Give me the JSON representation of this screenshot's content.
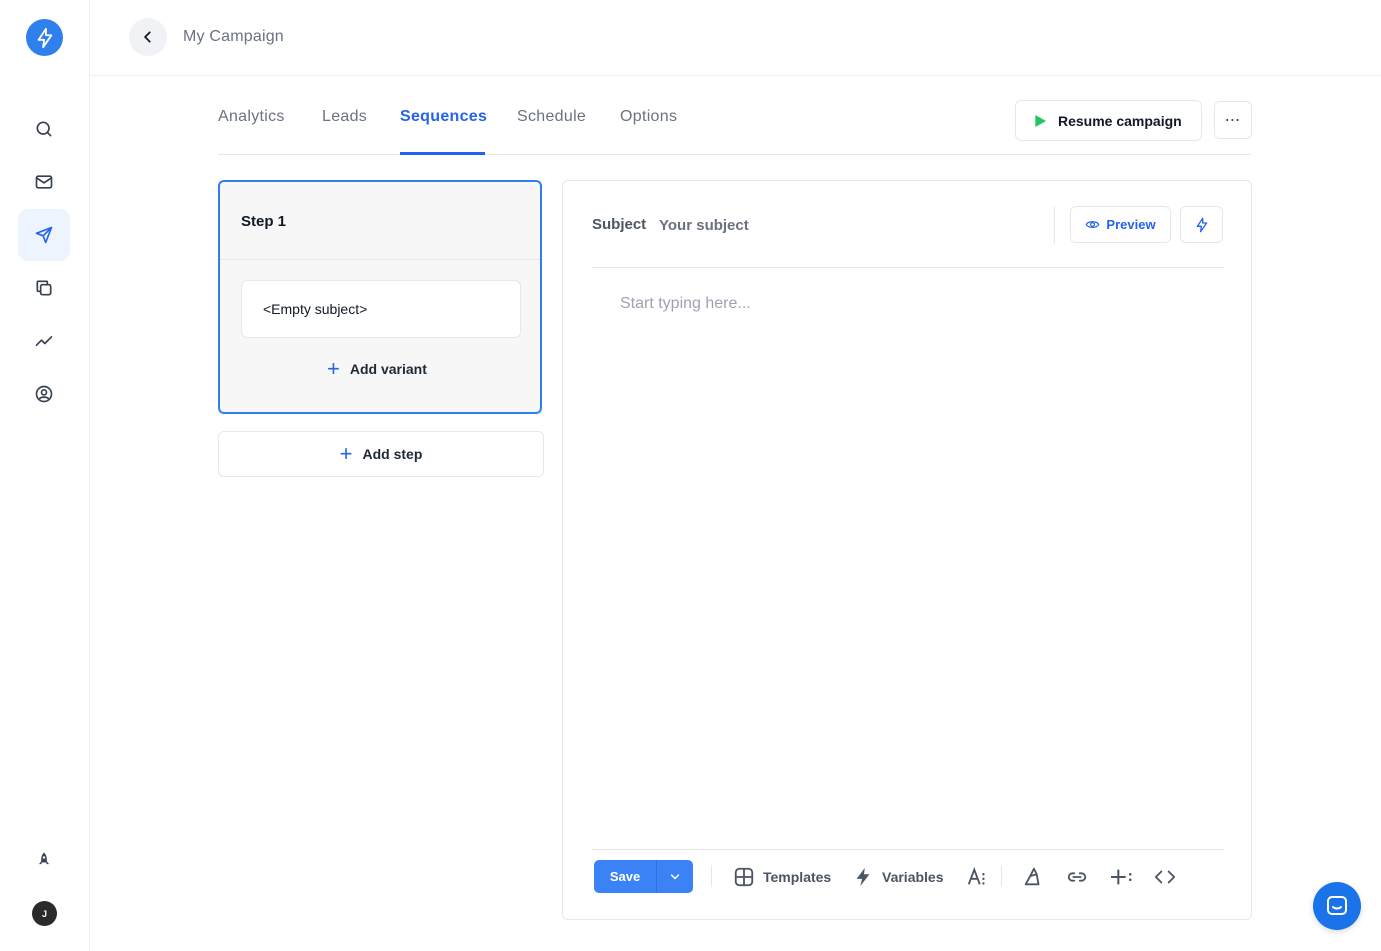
{
  "header": {
    "campaign_title": "My Campaign"
  },
  "tabs": [
    {
      "label": "Analytics"
    },
    {
      "label": "Leads"
    },
    {
      "label": "Sequences"
    },
    {
      "label": "Schedule"
    },
    {
      "label": "Options"
    }
  ],
  "actions": {
    "resume_label": "Resume campaign",
    "more_label": "⋯"
  },
  "sidebar": {
    "avatar_initial": "J"
  },
  "steps": {
    "step1_title": "Step 1",
    "variant_subject": "<Empty subject>",
    "add_variant_label": "Add variant",
    "add_step_label": "Add step"
  },
  "editor": {
    "subject_label": "Subject",
    "subject_placeholder": "Your subject",
    "preview_label": "Preview",
    "body_placeholder": "Start typing here...",
    "save_label": "Save",
    "templates_label": "Templates",
    "variables_label": "Variables"
  },
  "colors": {
    "accent": "#2563eb",
    "play": "#22c55e",
    "active_nav_bg": "#eef4fe"
  }
}
